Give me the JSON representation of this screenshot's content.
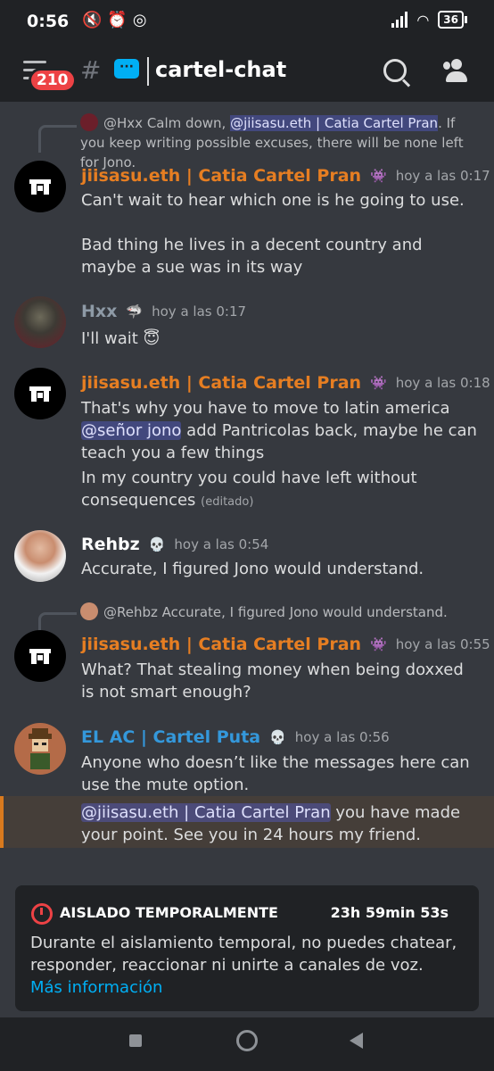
{
  "status_bar": {
    "time": "0:56",
    "left_icons": "🔇⏰◎",
    "battery": "36"
  },
  "header": {
    "badge": "210",
    "channel_name": "cartel-chat",
    "hash_glyph": "#",
    "thread_glyph": "💬"
  },
  "messages": [
    {
      "reply": {
        "name": "@Hxx",
        "text_before": "Calm down, ",
        "mention": "@jiisasu.eth | Catia Cartel Pran",
        "text_after": ". If you keep writing possible excuses, there will be none left for Jono."
      },
      "author": "jiisasu.eth | Catia Cartel Pran",
      "tag": "👾",
      "time": "hoy a las 0:17",
      "lines": [
        "Can't wait to hear which one is he going to use.",
        "Bad thing he lives in a decent country and maybe a sue was in its way"
      ]
    },
    {
      "author": "Hxx",
      "tag": "🦈",
      "time": "hoy a las 0:17",
      "text": "I'll wait",
      "emoji": "😇"
    },
    {
      "author": "jiisasu.eth | Catia Cartel Pran",
      "tag": "👾",
      "time": "hoy a las 0:18",
      "text_before": "That's why you have to move to latin america ",
      "mention": "@señor jono",
      "text_after": " add Pantricolas back, maybe he can teach you a few things",
      "line2": "In my country you could have left without consequences ",
      "edited": "(editado)"
    },
    {
      "author": "Rehbz",
      "tag": "💀",
      "time": "hoy a las 0:54",
      "text": "Accurate, I figured Jono would understand."
    },
    {
      "reply": {
        "name": "@Rehbz",
        "text": "Accurate, I figured Jono would understand."
      },
      "author": "jiisasu.eth | Catia Cartel Pran",
      "tag": "👾",
      "time": "hoy a las 0:55",
      "text": "What? That stealing money when being doxxed is not smart enough?"
    },
    {
      "author": "EL AC | Cartel Puta",
      "tag": "💀",
      "time": "hoy a las 0:56",
      "text": "Anyone who doesn’t like the messages here can use the mute option.",
      "mention": "@jiisasu.eth | Catia Cartel Pran",
      "text_after": " you have made your point.  See you in 24 hours my friend."
    }
  ],
  "timeout_notice": {
    "title": "AISLADO TEMPORALMENTE",
    "remaining": "23h 59min 53s",
    "body": "Durante el aislamiento temporal, no puedes chatear, responder, reaccionar ni unirte a canales de voz. ",
    "link": "Más información"
  },
  "colors": {
    "background": "#36393f",
    "header": "#202225",
    "author_orange": "#e67e22",
    "author_blue": "#3498db",
    "mention_bg": "#5865f2",
    "danger": "#ed4245",
    "link": "#00aff4"
  }
}
